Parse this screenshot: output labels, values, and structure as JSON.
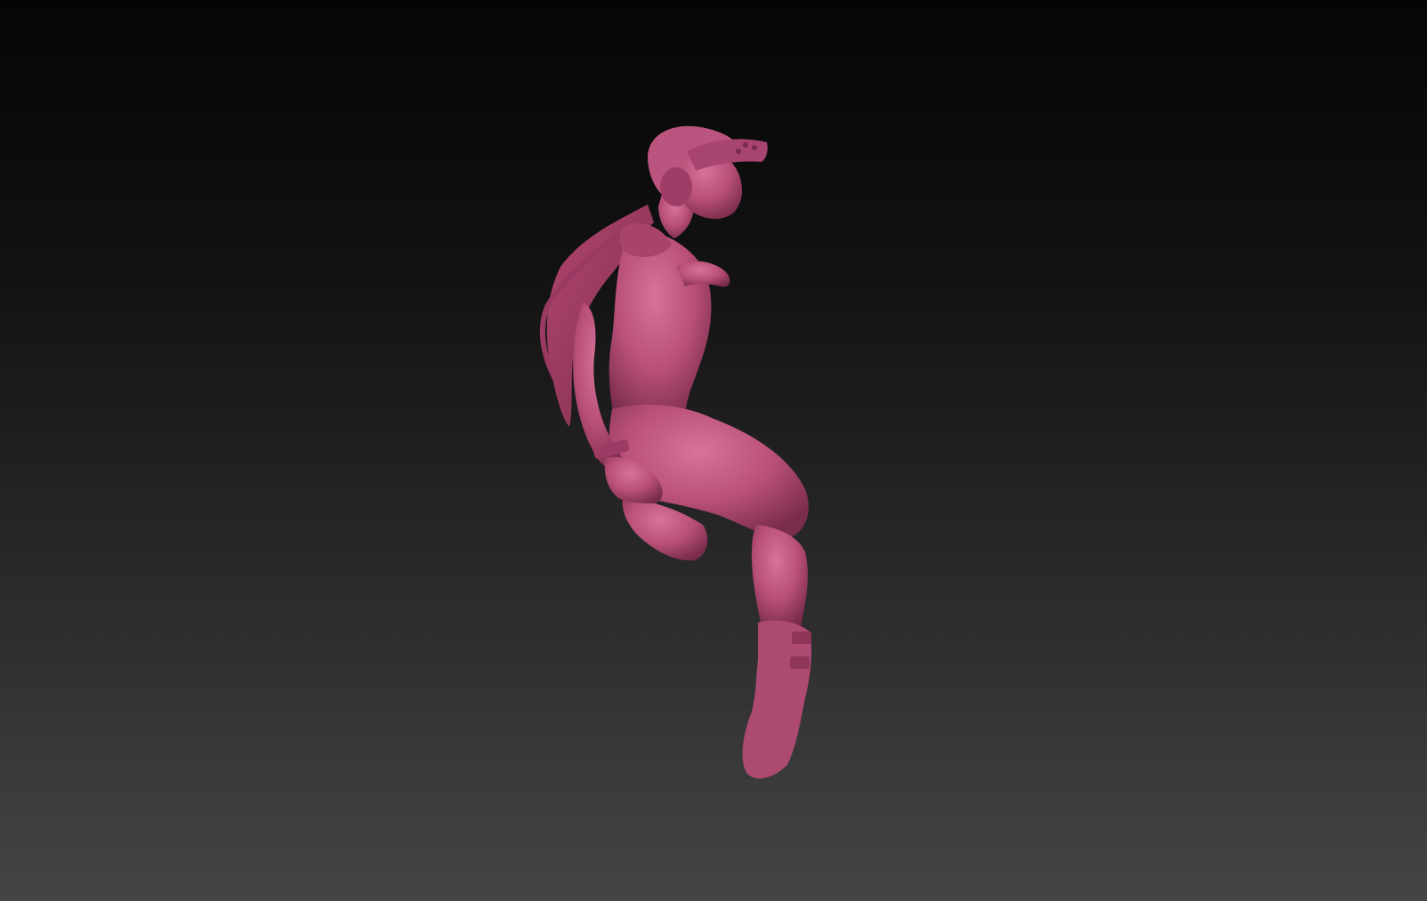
{
  "viewport": {
    "background_top": "#050505",
    "background_bottom": "#454545"
  },
  "model": {
    "subject": "sculpted-female-figure",
    "material_color": "#b84f78",
    "material_shadow": "#7a2c4c",
    "material_highlight": "#d7739b"
  }
}
